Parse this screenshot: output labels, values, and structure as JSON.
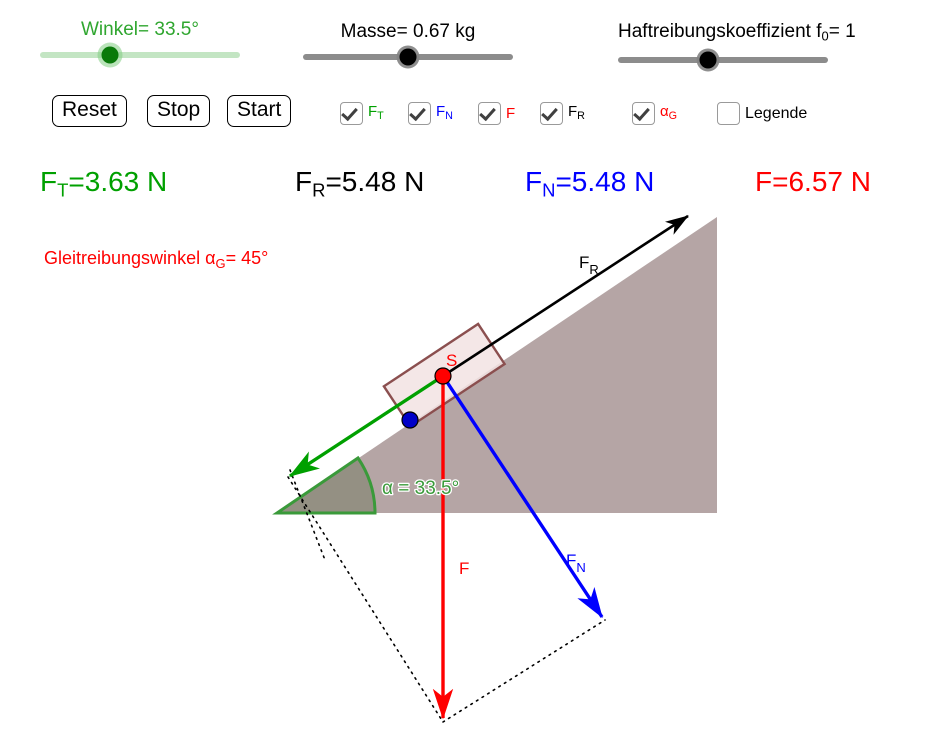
{
  "controls": {
    "sliders": [
      {
        "name": "winkel",
        "label_prefix": "Winkel= ",
        "value": "33.5",
        "unit": "°",
        "color": "#2fa62f",
        "track_color": "#c3e5c3",
        "thumb_style": "green",
        "thumb_percent": 35
      },
      {
        "name": "masse",
        "label_prefix": "Masse= ",
        "value": "0.67",
        "unit": " kg",
        "color": "#000000",
        "track_color": "#8c8c8c",
        "thumb_style": "gray",
        "thumb_percent": 50
      },
      {
        "name": "haftreibungskoeffizient",
        "label_prefix": "Haftreibungskoeffizient f",
        "label_sub": "0",
        "label_suffix": "= ",
        "value": "1",
        "unit": "",
        "color": "#000000",
        "track_color": "#8c8c8c",
        "thumb_style": "gray",
        "thumb_percent": 43
      }
    ],
    "buttons": [
      {
        "name": "reset",
        "label": "Reset"
      },
      {
        "name": "stop",
        "label": "Stop"
      },
      {
        "name": "start",
        "label": "Start"
      }
    ],
    "checkboxes": [
      {
        "name": "ft",
        "label": "F",
        "sub": "T",
        "checked": true,
        "color": "#00a000"
      },
      {
        "name": "fn",
        "label": "F",
        "sub": "N",
        "checked": true,
        "color": "#0000ff"
      },
      {
        "name": "f",
        "label": "F",
        "sub": "",
        "checked": true,
        "color": "#ff0000"
      },
      {
        "name": "fr",
        "label": "F",
        "sub": "R",
        "checked": true,
        "color": "#000000"
      },
      {
        "name": "alpha-g",
        "label": "α",
        "sub": "G",
        "checked": true,
        "color": "#ff0000"
      },
      {
        "name": "legende",
        "label": "Legende",
        "sub": "",
        "checked": false,
        "color": "#000000"
      }
    ]
  },
  "readouts": [
    {
      "name": "ft-readout",
      "symbol": "F",
      "sub": "T",
      "text": "=3.63 N",
      "color": "#00a000"
    },
    {
      "name": "fr-readout",
      "symbol": "F",
      "sub": "R",
      "text": "=5.48 N",
      "color": "#000000"
    },
    {
      "name": "fn-readout",
      "symbol": "F",
      "sub": "N",
      "text": "=5.48 N",
      "color": "#0000ff"
    },
    {
      "name": "f-readout",
      "symbol": "F",
      "sub": "",
      "text": "=6.57 N",
      "color": "#ff0000"
    }
  ],
  "note": {
    "prefix": "Gleitreibungswinkel α",
    "sub": "G",
    "suffix": "= 45°"
  },
  "scene": {
    "incline_fill": "#b5a5a5",
    "angle_label": "α = 33.5°",
    "center_label": "S",
    "vectors": [
      {
        "name": "ft-vector",
        "label": "",
        "color": "#00a000"
      },
      {
        "name": "fr-vector",
        "label": "F",
        "sub": "R",
        "color": "#000000"
      },
      {
        "name": "fn-vector",
        "label": "F",
        "sub": "N",
        "color": "#0000ff"
      },
      {
        "name": "f-vector",
        "label": "F",
        "sub": "",
        "color": "#ff0000"
      }
    ]
  }
}
